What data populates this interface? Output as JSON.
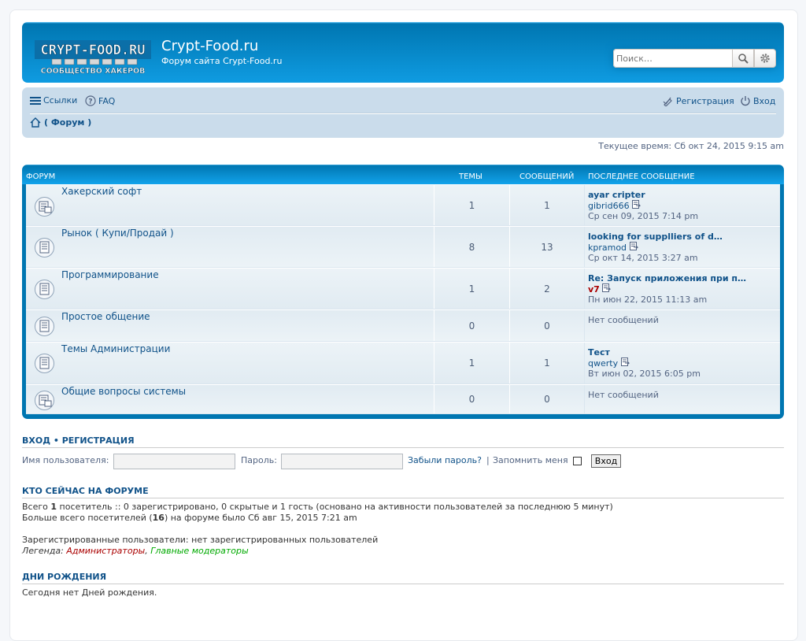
{
  "header": {
    "logo_text": "CRYPT-FOOD.RU",
    "logo_subtext": "СООБЩЕСТВО ХАКЕРОВ",
    "site_title": "Crypt-Food.ru",
    "site_description": "Форум сайта Crypt-Food.ru",
    "search_placeholder": "Поиск…"
  },
  "nav": {
    "links_label": "Ссылки",
    "faq_label": "FAQ",
    "register_label": "Регистрация",
    "login_label": "Вход",
    "breadcrumb": "( Форум )"
  },
  "current_time": "Текущее время: Сб окт 24, 2015 9:15 am",
  "forum_table": {
    "headers": {
      "forum": "ФОРУМ",
      "topics": "ТЕМЫ",
      "posts": "СООБЩЕНИЙ",
      "last_post": "ПОСЛЕДНЕЕ СООБЩЕНИЕ"
    },
    "rows": [
      {
        "name": "Хакерский софт",
        "topics": "1",
        "posts": "1",
        "last_title": "ayar cripter",
        "last_author": "gibrid666",
        "last_date": "Ср сен 09, 2015 7:14 pm",
        "author_color": "#105289"
      },
      {
        "name": "Рынок ( Купи/Продай )",
        "topics": "8",
        "posts": "13",
        "last_title": "looking for supplliers of d…",
        "last_author": "kpramod",
        "last_date": "Ср окт 14, 2015 3:27 am",
        "author_color": "#105289"
      },
      {
        "name": "Программирование",
        "topics": "1",
        "posts": "2",
        "last_title": "Re: Запуск приложения при п…",
        "last_author": "v7",
        "last_date": "Пн июн 22, 2015 11:13 am",
        "author_color": "#aa0000"
      },
      {
        "name": "Простое общение",
        "topics": "0",
        "posts": "0",
        "no_posts": "Нет сообщений"
      },
      {
        "name": "Темы Администрации",
        "topics": "1",
        "posts": "1",
        "last_title": "Тест",
        "last_author": "qwerty",
        "last_date": "Вт июн 02, 2015 6:05 pm",
        "author_color": "#105289"
      },
      {
        "name": "Общие вопросы системы",
        "topics": "0",
        "posts": "0",
        "no_posts": "Нет сообщений"
      }
    ]
  },
  "login": {
    "section_login": "ВХОД",
    "section_sep": "•",
    "section_register": "РЕГИСТРАЦИЯ",
    "username_label": "Имя пользователя:",
    "password_label": "Пароль:",
    "forgot_label": "Забыли пароль?",
    "sep": "|",
    "remember_label": "Запомнить меня",
    "submit_label": "Вход"
  },
  "online": {
    "title": "КТО СЕЙЧАС НА ФОРУМЕ",
    "line1_pre": "Всего ",
    "line1_count": "1",
    "line1_post": " посетитель :: 0 зарегистрировано, 0 скрытые и 1 гость (основано на активности пользователей за последнюю 5 минут)",
    "line2_pre": "Больше всего посетителей (",
    "line2_count": "16",
    "line2_post": ") на форуме было Сб авг 15, 2015 7:21 am",
    "registered": "Зарегистрированные пользователи: нет зарегистрированных пользователей",
    "legend_label": "Легенда: ",
    "legend_admins": "Администраторы",
    "legend_comma": ", ",
    "legend_mods": "Главные модераторы"
  },
  "birthdays": {
    "title": "ДНИ РОЖДЕНИЯ",
    "text": "Сегодня нет Дней рождения."
  }
}
